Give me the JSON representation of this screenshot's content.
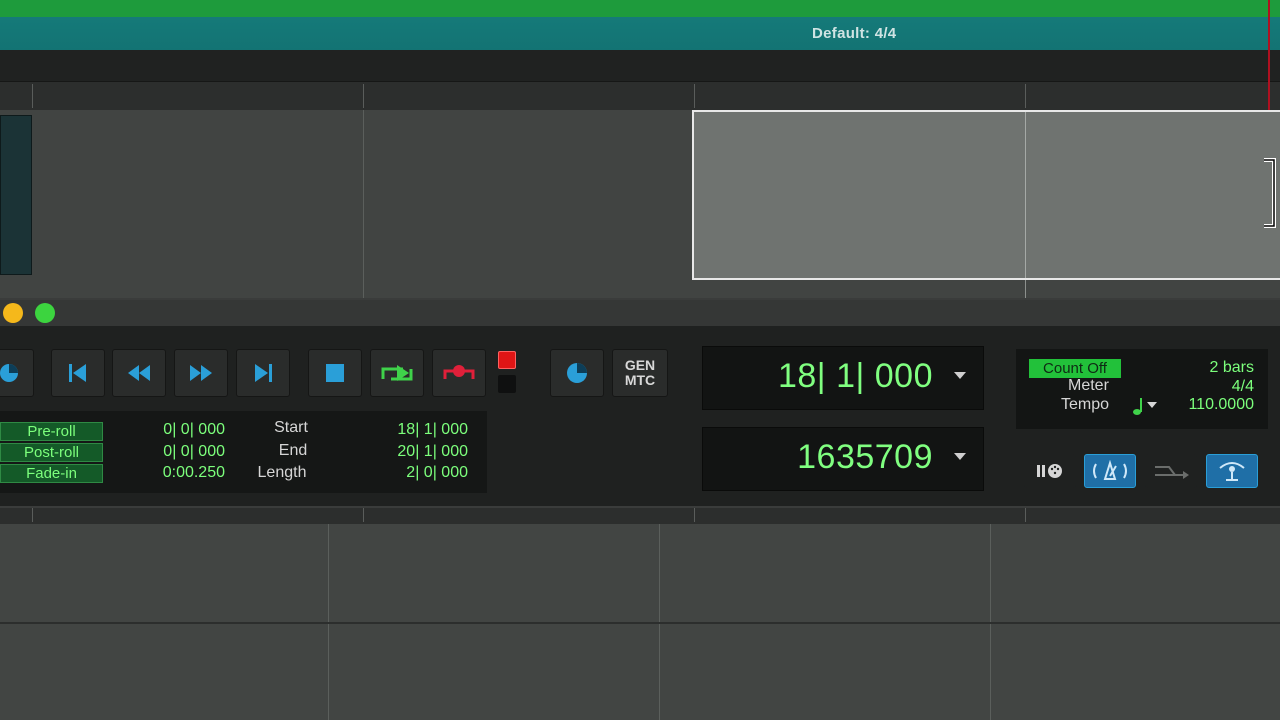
{
  "meter_ruler": {
    "label": "Default: 4/4"
  },
  "transport": {
    "buttons": [
      {
        "name": "online-button",
        "icon": "online-icon",
        "color": "#2a9fd8"
      },
      {
        "name": "return-to-zero-button",
        "icon": "return-to-zero-icon"
      },
      {
        "name": "rewind-button",
        "icon": "rewind-icon"
      },
      {
        "name": "fast-forward-button",
        "icon": "fast-forward-icon"
      },
      {
        "name": "go-to-end-button",
        "icon": "go-to-end-icon"
      },
      {
        "name": "stop-button",
        "icon": "stop-icon",
        "color": "#2a9fd8"
      },
      {
        "name": "play-button",
        "icon": "play-loop-icon",
        "color": "#3fd24a"
      },
      {
        "name": "record-button",
        "icon": "record-icon",
        "color": "#e0203a"
      }
    ],
    "gen_mtc": {
      "line1": "GEN",
      "line2": "MTC"
    },
    "pre_roll": {
      "label": "Pre-roll",
      "value": "0| 0| 000"
    },
    "post_roll": {
      "label": "Post-roll",
      "value": "0| 0| 000"
    },
    "fade_in": {
      "label": "Fade-in",
      "value": "0:00.250"
    },
    "start": {
      "label": "Start",
      "value": "18| 1| 000"
    },
    "end": {
      "label": "End",
      "value": "20| 1| 000"
    },
    "length": {
      "label": "Length",
      "value": "2| 0| 000"
    },
    "main_counter": "18| 1| 000",
    "sub_counter": "1635709",
    "count_off": {
      "label": "Count Off",
      "value": "2 bars"
    },
    "meter": {
      "label": "Meter",
      "value": "4/4"
    },
    "tempo": {
      "label": "Tempo",
      "value": "110.0000"
    }
  },
  "colors": {
    "counter_green": "#80ff80",
    "accent_blue": "#2a9fd8",
    "count_off_bg": "#22c13a"
  }
}
